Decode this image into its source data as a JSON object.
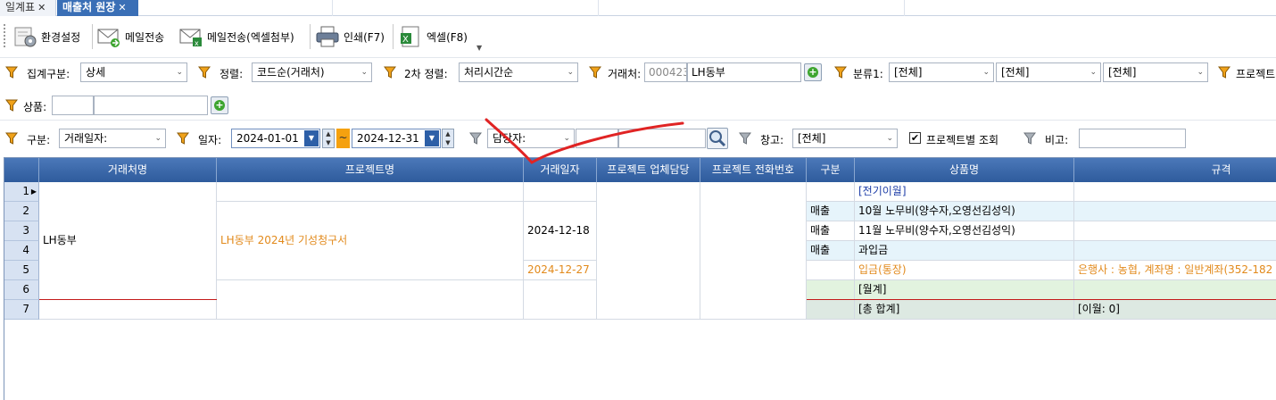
{
  "tabs": [
    {
      "label": "일계표"
    },
    {
      "label": "매출처 원장"
    }
  ],
  "toolbar": {
    "settings_label": "환경설정",
    "mail_label": "메일전송",
    "mail_excel_label": "메일전송(엑셀첨부)",
    "print_label": "인쇄(F7)",
    "excel_label": "엑셀(F8)"
  },
  "filters": {
    "aggregate": {
      "label": "집계구분:",
      "value": "상세"
    },
    "sort": {
      "label": "정렬:",
      "value": "코드순(거래처)"
    },
    "sort2": {
      "label": "2차 정렬:",
      "value": "처리시간순"
    },
    "client": {
      "label": "거래처:",
      "code": "000423",
      "name": "LH동부"
    },
    "category1": {
      "label": "분류1:",
      "v1": "[전체]",
      "v2": "[전체]",
      "v3": "[전체]"
    },
    "project_cut": "프로젝트",
    "product": {
      "label": "상품:",
      "code": "",
      "name": ""
    },
    "type": {
      "label": "구분:",
      "value": "거래일자:"
    },
    "date": {
      "label": "일자:",
      "from": "2024-01-01",
      "to": "2024-12-31",
      "tilde": "~"
    },
    "manager": {
      "value": "담당자:",
      "code": "",
      "name": ""
    },
    "warehouse": {
      "label": "창고:",
      "value": "[전체]"
    },
    "project_view": {
      "label": "프로젝트별 조회",
      "checked": "✔"
    },
    "memo": {
      "label": "비고:",
      "value": ""
    }
  },
  "grid": {
    "columns": [
      "거래처명",
      "프로젝트명",
      "거래일자",
      "프로젝트 업체담당",
      "프로젝트 전화번호",
      "구분",
      "상품명",
      "규격"
    ],
    "row_numbers": [
      "1",
      "2",
      "3",
      "4",
      "5",
      "6",
      "7"
    ],
    "client_name": "LH동부",
    "project_name": "LH동부 2024년 기성청구서",
    "date_a": "2024-12-18",
    "date_b": "2024-12-27",
    "rows": [
      {
        "type": "",
        "product": "[전기이월]",
        "spec": ""
      },
      {
        "type": "매출",
        "product": "10월 노무비(양수자,오영선김성익)",
        "spec": ""
      },
      {
        "type": "매출",
        "product": "11월 노무비(양수자,오영선김성익)",
        "spec": ""
      },
      {
        "type": "매출",
        "product": "과입금",
        "spec": ""
      },
      {
        "type": "",
        "product": "입금(통장)",
        "spec": "은행사 : 농협, 계좌명 : 일반계좌(352-182"
      },
      {
        "type": "",
        "product": "[월계]",
        "spec": ""
      },
      {
        "type": "",
        "product": "[총 합계]",
        "spec": "[이월: 0]"
      }
    ]
  },
  "colors": {
    "header": "#3a69ab",
    "accent": "#f5a10f",
    "annotation": "#e02424"
  }
}
